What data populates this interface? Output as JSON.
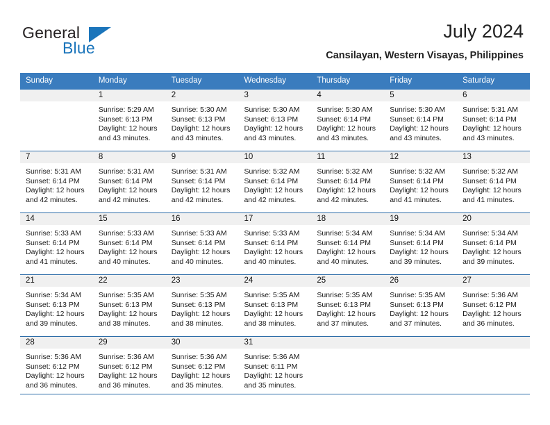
{
  "brand": {
    "word_one": "General",
    "word_two": "Blue",
    "triangle_icon": "triangle-logo-icon",
    "primary_color": "#1b75bb",
    "dark_color": "#231f20"
  },
  "header": {
    "title": "July 2024",
    "subtitle": "Cansilayan, Western Visayas, Philippines"
  },
  "theme": {
    "header_row_bg": "#3a7cbe",
    "header_row_text": "#ffffff",
    "daynum_band_bg": "#f0f0f0",
    "grid_line": "#2c6ca8"
  },
  "weekdays": [
    "Sunday",
    "Monday",
    "Tuesday",
    "Wednesday",
    "Thursday",
    "Friday",
    "Saturday"
  ],
  "labels": {
    "sunrise_prefix": "Sunrise:",
    "sunset_prefix": "Sunset:",
    "daylight_prefix": "Daylight:"
  },
  "weeks": [
    [
      {
        "day": "",
        "blank": true,
        "sunrise": "",
        "sunset": "",
        "daylight_line1": "",
        "daylight_line2": ""
      },
      {
        "day": "1",
        "sunrise": "Sunrise: 5:29 AM",
        "sunset": "Sunset: 6:13 PM",
        "daylight_line1": "Daylight: 12 hours",
        "daylight_line2": "and 43 minutes."
      },
      {
        "day": "2",
        "sunrise": "Sunrise: 5:30 AM",
        "sunset": "Sunset: 6:13 PM",
        "daylight_line1": "Daylight: 12 hours",
        "daylight_line2": "and 43 minutes."
      },
      {
        "day": "3",
        "sunrise": "Sunrise: 5:30 AM",
        "sunset": "Sunset: 6:13 PM",
        "daylight_line1": "Daylight: 12 hours",
        "daylight_line2": "and 43 minutes."
      },
      {
        "day": "4",
        "sunrise": "Sunrise: 5:30 AM",
        "sunset": "Sunset: 6:14 PM",
        "daylight_line1": "Daylight: 12 hours",
        "daylight_line2": "and 43 minutes."
      },
      {
        "day": "5",
        "sunrise": "Sunrise: 5:30 AM",
        "sunset": "Sunset: 6:14 PM",
        "daylight_line1": "Daylight: 12 hours",
        "daylight_line2": "and 43 minutes."
      },
      {
        "day": "6",
        "sunrise": "Sunrise: 5:31 AM",
        "sunset": "Sunset: 6:14 PM",
        "daylight_line1": "Daylight: 12 hours",
        "daylight_line2": "and 43 minutes."
      }
    ],
    [
      {
        "day": "7",
        "sunrise": "Sunrise: 5:31 AM",
        "sunset": "Sunset: 6:14 PM",
        "daylight_line1": "Daylight: 12 hours",
        "daylight_line2": "and 42 minutes."
      },
      {
        "day": "8",
        "sunrise": "Sunrise: 5:31 AM",
        "sunset": "Sunset: 6:14 PM",
        "daylight_line1": "Daylight: 12 hours",
        "daylight_line2": "and 42 minutes."
      },
      {
        "day": "9",
        "sunrise": "Sunrise: 5:31 AM",
        "sunset": "Sunset: 6:14 PM",
        "daylight_line1": "Daylight: 12 hours",
        "daylight_line2": "and 42 minutes."
      },
      {
        "day": "10",
        "sunrise": "Sunrise: 5:32 AM",
        "sunset": "Sunset: 6:14 PM",
        "daylight_line1": "Daylight: 12 hours",
        "daylight_line2": "and 42 minutes."
      },
      {
        "day": "11",
        "sunrise": "Sunrise: 5:32 AM",
        "sunset": "Sunset: 6:14 PM",
        "daylight_line1": "Daylight: 12 hours",
        "daylight_line2": "and 42 minutes."
      },
      {
        "day": "12",
        "sunrise": "Sunrise: 5:32 AM",
        "sunset": "Sunset: 6:14 PM",
        "daylight_line1": "Daylight: 12 hours",
        "daylight_line2": "and 41 minutes."
      },
      {
        "day": "13",
        "sunrise": "Sunrise: 5:32 AM",
        "sunset": "Sunset: 6:14 PM",
        "daylight_line1": "Daylight: 12 hours",
        "daylight_line2": "and 41 minutes."
      }
    ],
    [
      {
        "day": "14",
        "sunrise": "Sunrise: 5:33 AM",
        "sunset": "Sunset: 6:14 PM",
        "daylight_line1": "Daylight: 12 hours",
        "daylight_line2": "and 41 minutes."
      },
      {
        "day": "15",
        "sunrise": "Sunrise: 5:33 AM",
        "sunset": "Sunset: 6:14 PM",
        "daylight_line1": "Daylight: 12 hours",
        "daylight_line2": "and 40 minutes."
      },
      {
        "day": "16",
        "sunrise": "Sunrise: 5:33 AM",
        "sunset": "Sunset: 6:14 PM",
        "daylight_line1": "Daylight: 12 hours",
        "daylight_line2": "and 40 minutes."
      },
      {
        "day": "17",
        "sunrise": "Sunrise: 5:33 AM",
        "sunset": "Sunset: 6:14 PM",
        "daylight_line1": "Daylight: 12 hours",
        "daylight_line2": "and 40 minutes."
      },
      {
        "day": "18",
        "sunrise": "Sunrise: 5:34 AM",
        "sunset": "Sunset: 6:14 PM",
        "daylight_line1": "Daylight: 12 hours",
        "daylight_line2": "and 40 minutes."
      },
      {
        "day": "19",
        "sunrise": "Sunrise: 5:34 AM",
        "sunset": "Sunset: 6:14 PM",
        "daylight_line1": "Daylight: 12 hours",
        "daylight_line2": "and 39 minutes."
      },
      {
        "day": "20",
        "sunrise": "Sunrise: 5:34 AM",
        "sunset": "Sunset: 6:14 PM",
        "daylight_line1": "Daylight: 12 hours",
        "daylight_line2": "and 39 minutes."
      }
    ],
    [
      {
        "day": "21",
        "sunrise": "Sunrise: 5:34 AM",
        "sunset": "Sunset: 6:13 PM",
        "daylight_line1": "Daylight: 12 hours",
        "daylight_line2": "and 39 minutes."
      },
      {
        "day": "22",
        "sunrise": "Sunrise: 5:35 AM",
        "sunset": "Sunset: 6:13 PM",
        "daylight_line1": "Daylight: 12 hours",
        "daylight_line2": "and 38 minutes."
      },
      {
        "day": "23",
        "sunrise": "Sunrise: 5:35 AM",
        "sunset": "Sunset: 6:13 PM",
        "daylight_line1": "Daylight: 12 hours",
        "daylight_line2": "and 38 minutes."
      },
      {
        "day": "24",
        "sunrise": "Sunrise: 5:35 AM",
        "sunset": "Sunset: 6:13 PM",
        "daylight_line1": "Daylight: 12 hours",
        "daylight_line2": "and 38 minutes."
      },
      {
        "day": "25",
        "sunrise": "Sunrise: 5:35 AM",
        "sunset": "Sunset: 6:13 PM",
        "daylight_line1": "Daylight: 12 hours",
        "daylight_line2": "and 37 minutes."
      },
      {
        "day": "26",
        "sunrise": "Sunrise: 5:35 AM",
        "sunset": "Sunset: 6:13 PM",
        "daylight_line1": "Daylight: 12 hours",
        "daylight_line2": "and 37 minutes."
      },
      {
        "day": "27",
        "sunrise": "Sunrise: 5:36 AM",
        "sunset": "Sunset: 6:12 PM",
        "daylight_line1": "Daylight: 12 hours",
        "daylight_line2": "and 36 minutes."
      }
    ],
    [
      {
        "day": "28",
        "sunrise": "Sunrise: 5:36 AM",
        "sunset": "Sunset: 6:12 PM",
        "daylight_line1": "Daylight: 12 hours",
        "daylight_line2": "and 36 minutes."
      },
      {
        "day": "29",
        "sunrise": "Sunrise: 5:36 AM",
        "sunset": "Sunset: 6:12 PM",
        "daylight_line1": "Daylight: 12 hours",
        "daylight_line2": "and 36 minutes."
      },
      {
        "day": "30",
        "sunrise": "Sunrise: 5:36 AM",
        "sunset": "Sunset: 6:12 PM",
        "daylight_line1": "Daylight: 12 hours",
        "daylight_line2": "and 35 minutes."
      },
      {
        "day": "31",
        "sunrise": "Sunrise: 5:36 AM",
        "sunset": "Sunset: 6:11 PM",
        "daylight_line1": "Daylight: 12 hours",
        "daylight_line2": "and 35 minutes."
      },
      {
        "day": "",
        "blank": true,
        "sunrise": "",
        "sunset": "",
        "daylight_line1": "",
        "daylight_line2": ""
      },
      {
        "day": "",
        "blank": true,
        "sunrise": "",
        "sunset": "",
        "daylight_line1": "",
        "daylight_line2": ""
      },
      {
        "day": "",
        "blank": true,
        "sunrise": "",
        "sunset": "",
        "daylight_line1": "",
        "daylight_line2": ""
      }
    ]
  ]
}
